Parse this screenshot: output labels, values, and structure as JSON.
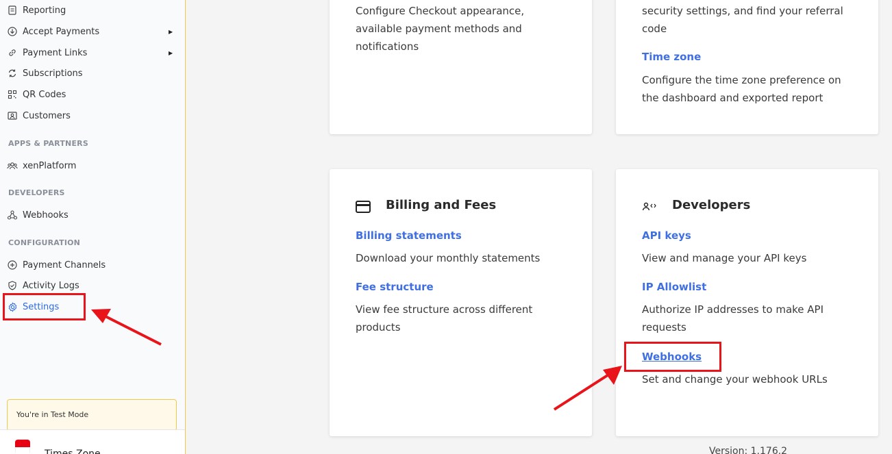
{
  "sidebar": {
    "items": [
      {
        "label": "Reporting",
        "icon": "document-icon"
      },
      {
        "label": "Accept Payments",
        "icon": "download-circle-icon"
      },
      {
        "label": "Payment Links",
        "icon": "link-icon"
      },
      {
        "label": "Subscriptions",
        "icon": "refresh-icon"
      },
      {
        "label": "QR Codes",
        "icon": "qr-code-icon"
      },
      {
        "label": "Customers",
        "icon": "customer-card-icon"
      }
    ],
    "sections": {
      "apps_partners": "APPS & PARTNERS",
      "developers": "DEVELOPERS",
      "configuration": "CONFIGURATION"
    },
    "apps_items": [
      {
        "label": "xenPlatform",
        "icon": "people-icon"
      }
    ],
    "developer_items": [
      {
        "label": "Webhooks",
        "icon": "webhook-icon"
      }
    ],
    "config_items": [
      {
        "label": "Payment Channels",
        "icon": "plus-circle-icon"
      },
      {
        "label": "Activity Logs",
        "icon": "shield-check-icon"
      },
      {
        "label": "Settings",
        "icon": "gear-icon"
      }
    ],
    "test_mode": "You're in Test Mode",
    "time_zone": "Times Zone"
  },
  "cards": {
    "checkout": {
      "description": "Configure Checkout appearance, available payment methods and notifications"
    },
    "account": {
      "description": "security settings, and find your referral code",
      "timezone_link": "Time zone",
      "timezone_desc": "Configure the time zone preference on the dashboard and exported report"
    },
    "billing": {
      "title": "Billing and Fees",
      "links": [
        {
          "label": "Billing statements",
          "desc": "Download your monthly statements"
        },
        {
          "label": "Fee structure",
          "desc": "View fee structure across different products"
        }
      ]
    },
    "developers": {
      "title": "Developers",
      "links": [
        {
          "label": "API keys",
          "desc": "View and manage your API keys"
        },
        {
          "label": "IP Allowlist",
          "desc": "Authorize IP addresses to make API requests"
        },
        {
          "label": "Webhooks",
          "desc": "Set and change your webhook URLs"
        }
      ]
    }
  },
  "version": "Version: 1.176.2",
  "colors": {
    "highlight": "#e8141a",
    "link": "#3f6fe0",
    "active": "#2d6ae3"
  }
}
